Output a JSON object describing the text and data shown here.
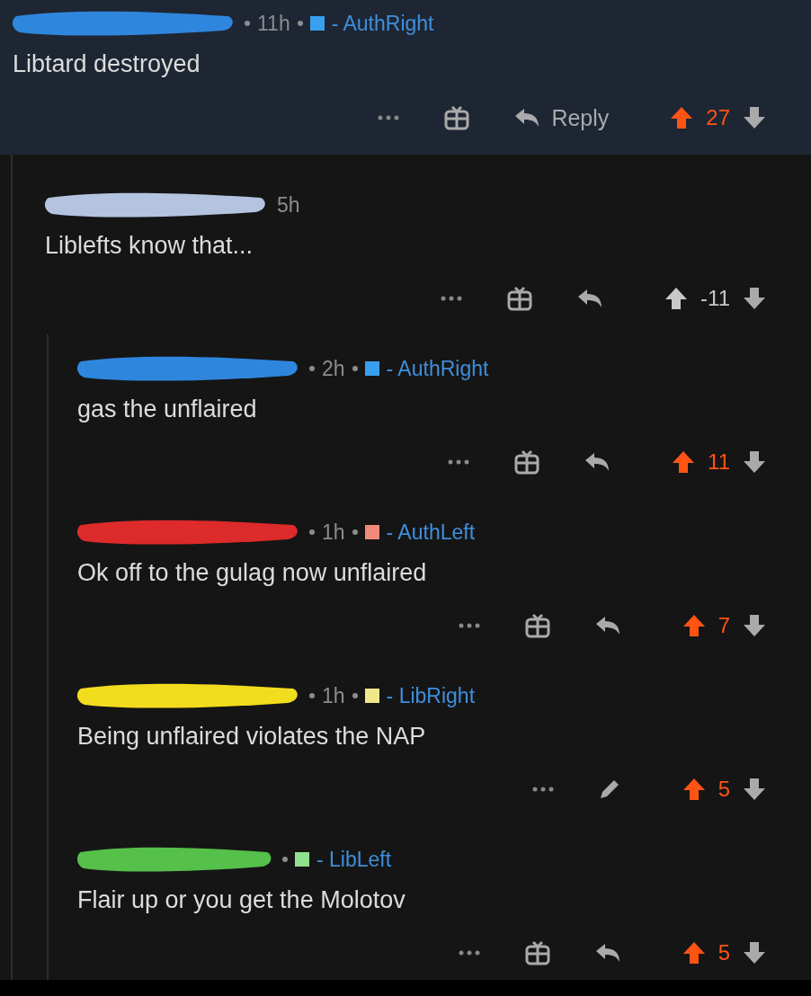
{
  "comments": [
    {
      "highlighted": true,
      "redaction": {
        "color": "#2f86dd"
      },
      "time": "11h",
      "flair": {
        "color": "#39a0f0",
        "text": "- AuthRight"
      },
      "body": "Libtard destroyed",
      "own": false,
      "reply_label": "Reply",
      "score": "27",
      "upvoted": true,
      "children": [
        {
          "highlighted": false,
          "redaction": {
            "color": "#b3c3e0"
          },
          "time": "5h",
          "body": "Liblefts know that...",
          "own": false,
          "score": "-11",
          "upvoted": false,
          "children": [
            {
              "highlighted": false,
              "redaction": {
                "color": "#2f86dd"
              },
              "time": "2h",
              "flair": {
                "color": "#39a0f0",
                "text": "- AuthRight"
              },
              "body": "gas the unflaired",
              "own": false,
              "score": "11",
              "upvoted": true
            },
            {
              "highlighted": false,
              "redaction": {
                "color": "#dd2a2a"
              },
              "time": "1h",
              "flair": {
                "color": "#f08a7a",
                "text": "- AuthLeft"
              },
              "body": "Ok off to the gulag now unflaired",
              "own": false,
              "score": "7",
              "upvoted": true
            },
            {
              "highlighted": false,
              "redaction": {
                "color": "#f2dc1e"
              },
              "time": "1h",
              "flair": {
                "color": "#f0e68a",
                "text": "- LibRight"
              },
              "body": "Being unflaired violates the NAP",
              "own": true,
              "score": "5",
              "upvoted": true
            },
            {
              "highlighted": false,
              "redaction": {
                "color": "#55c04a"
              },
              "flair": {
                "color": "#8fe08f",
                "text": "- LibLeft"
              },
              "body": "Flair up or you get the Molotov",
              "own": false,
              "score": "5",
              "upvoted": true
            }
          ]
        }
      ]
    }
  ]
}
